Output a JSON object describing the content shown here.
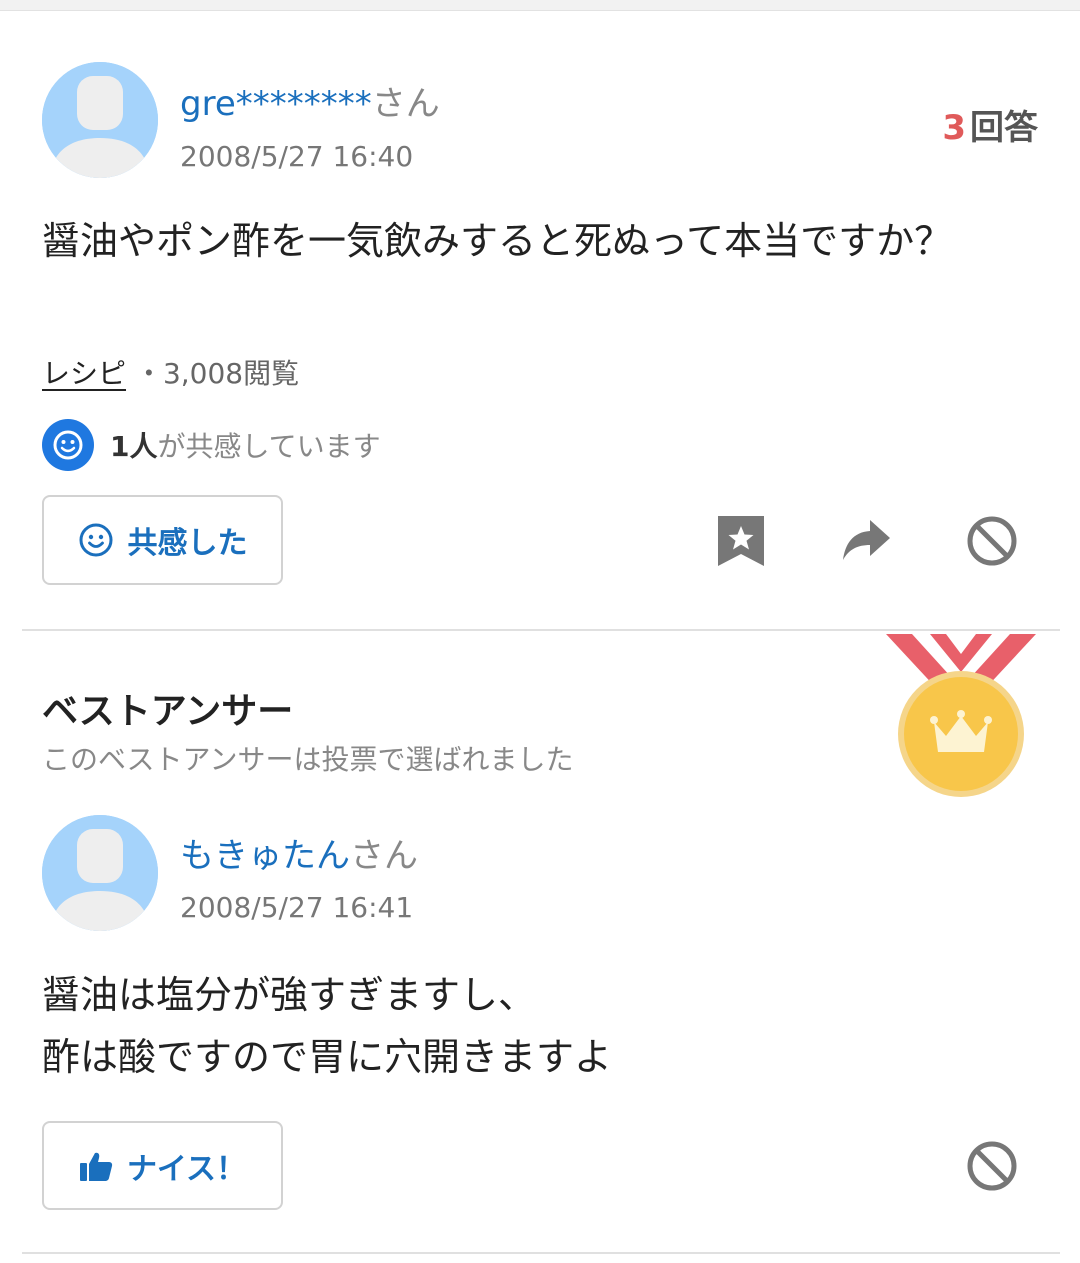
{
  "question": {
    "username": "gre********",
    "honorific": "さん",
    "date": "2008/5/27 16:40",
    "answer_count": "3",
    "answer_count_label": "回答",
    "text": "醤油やポン酢を一気飲みすると死ぬって本当ですか？",
    "category": "レシピ",
    "separator": "・",
    "views": "3,008閲覧",
    "empathy_count": "1人",
    "empathy_text": "が共感しています",
    "empathy_button_label": "共感した"
  },
  "best_answer": {
    "title": "ベストアンサー",
    "subtitle": "このベストアンサーは投票で選ばれました",
    "username": "もきゅたん",
    "honorific": "さん",
    "date": "2008/5/27 16:41",
    "lines": [
      "醤油は塩分が強すぎますし、",
      "酢は酸ですので胃に穴開きますよ"
    ],
    "nice_button_label": "ナイス！"
  },
  "icons": {
    "avatar": "default-user-avatar",
    "empathy": "smile-icon",
    "bookmark": "bookmark-star-icon",
    "share": "share-arrow-icon",
    "block": "block-icon",
    "medal": "crown-medal-icon",
    "thumbs_up": "thumbs-up-icon"
  },
  "colors": {
    "link_blue": "#1a6fbd",
    "accent_blue": "#1f78e0",
    "answer_count_red": "#e05a5a",
    "avatar_bg": "#a5d3fb",
    "medal_gold": "#f8c64a",
    "ribbon_red": "#e8606a"
  }
}
